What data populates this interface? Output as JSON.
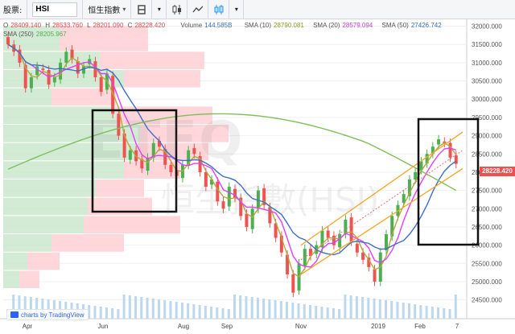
{
  "toolbar": {
    "stock_label": "股票:",
    "symbol": "HSI",
    "index_select": "恒生指數",
    "interval_icon": "bar-interval-icon",
    "candle_icon": "candlestick-icon",
    "line_icon": "line-chart-icon",
    "indicator_icon": "indicator-icon",
    "dropdown_arrow": "▾"
  },
  "legend": {
    "ohlc": [
      {
        "key": "O",
        "value": "28409.140"
      },
      {
        "key": "H",
        "value": "28533.760"
      },
      {
        "key": "L",
        "value": "28201.090"
      },
      {
        "key": "C",
        "value": "28228.420"
      }
    ],
    "volume_label": "Volume",
    "volume_value": "144.585B",
    "sma10_label": "SMA (10)",
    "sma10_value": "28790.081",
    "sma20_label": "SMA (20)",
    "sma20_value": "28579.094",
    "sma50_label": "SMA (50)",
    "sma50_value": "27426.742",
    "sma250_label": "SMA (250)",
    "sma250_value": "28205.967"
  },
  "watermark_text": "ETFQ",
  "watermark_sub": "恒生指數(HSI)",
  "price_tag": "28228.420",
  "branding": "charts by TradingView",
  "colors": {
    "up": "#4caf50",
    "down": "#ef5350",
    "sma10": "#b5a642",
    "sma20": "#e040fb",
    "sma50": "#3f6fc6",
    "sma250": "#7fbf5a",
    "channel": "#f5a623",
    "volume_profile_up": "#c8e6c9",
    "volume_profile_down": "#ffcdd2",
    "price_tag": "#ef4f4f"
  },
  "chart_data": {
    "type": "candlestick",
    "y_axis_ticks": [
      "32000.000",
      "31500.000",
      "31000.000",
      "30500.000",
      "30000.000",
      "29500.000",
      "29000.000",
      "28500.000",
      "28000.000",
      "27500.000",
      "27000.000",
      "26500.000",
      "26000.000",
      "25500.000",
      "25000.000",
      "24500.000"
    ],
    "ylim": [
      24250,
      32100
    ],
    "x_axis_ticks": [
      "Apr",
      "Jun",
      "Aug",
      "Sep",
      "Nov",
      "2019",
      "Feb",
      "7"
    ],
    "close_series_approx": [
      31500,
      31300,
      31000,
      30300,
      30600,
      30900,
      30800,
      30400,
      30600,
      31000,
      31300,
      31100,
      30700,
      30900,
      31100,
      30600,
      30200,
      30700,
      29600,
      29000,
      28400,
      28600,
      28300,
      28100,
      28400,
      28800,
      28700,
      28200,
      28000,
      27900,
      28200,
      28600,
      28500,
      28000,
      27600,
      27800,
      27200,
      27000,
      27600,
      27300,
      26800,
      26500,
      27000,
      27500,
      27100,
      26600,
      26200,
      25800,
      25200,
      24700,
      25500,
      25900,
      25700,
      26000,
      26400,
      26200,
      26000,
      26300,
      26700,
      26100,
      25800,
      25600,
      25400,
      25000,
      25800,
      26300,
      26800,
      27100,
      27400,
      27800,
      28000,
      28300,
      28500,
      28700,
      28900,
      28800,
      28400,
      28228
    ],
    "sma250_approx": "long arc peaking near 29600 around Sep and declining to 28205 at right edge",
    "annotations": [
      "box around Jun drawdown",
      "box around Feb rally",
      "ascending channel Nov–Feb"
    ]
  }
}
